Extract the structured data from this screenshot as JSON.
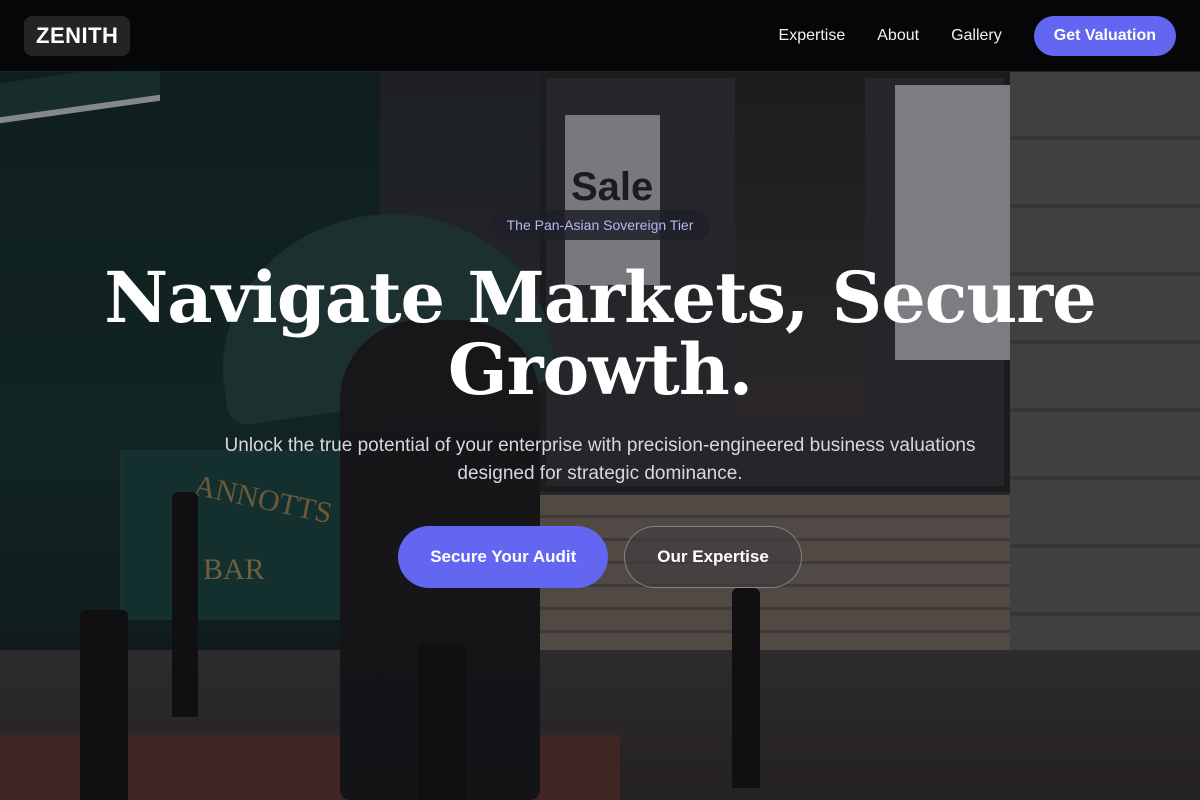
{
  "nav": {
    "logo": "ZENITH",
    "links": [
      "Expertise",
      "About",
      "Gallery"
    ],
    "cta_label": "Get Valuation"
  },
  "hero": {
    "badge": "The Pan-Asian Sovereign Tier",
    "headline": "Navigate Markets, Secure Growth.",
    "subtitle": "Unlock the true potential of your enterprise with precision-engineered business valuations designed for strategic dominance.",
    "primary_button": "Secure Your Audit",
    "secondary_button": "Our Expertise"
  },
  "colors": {
    "accent": "#6366f1",
    "nav_bg": "#000000",
    "badge_text": "#b3b8f5"
  },
  "background": {
    "signage": [
      "ANNOTTS",
      "BAR",
      "Sale"
    ]
  }
}
